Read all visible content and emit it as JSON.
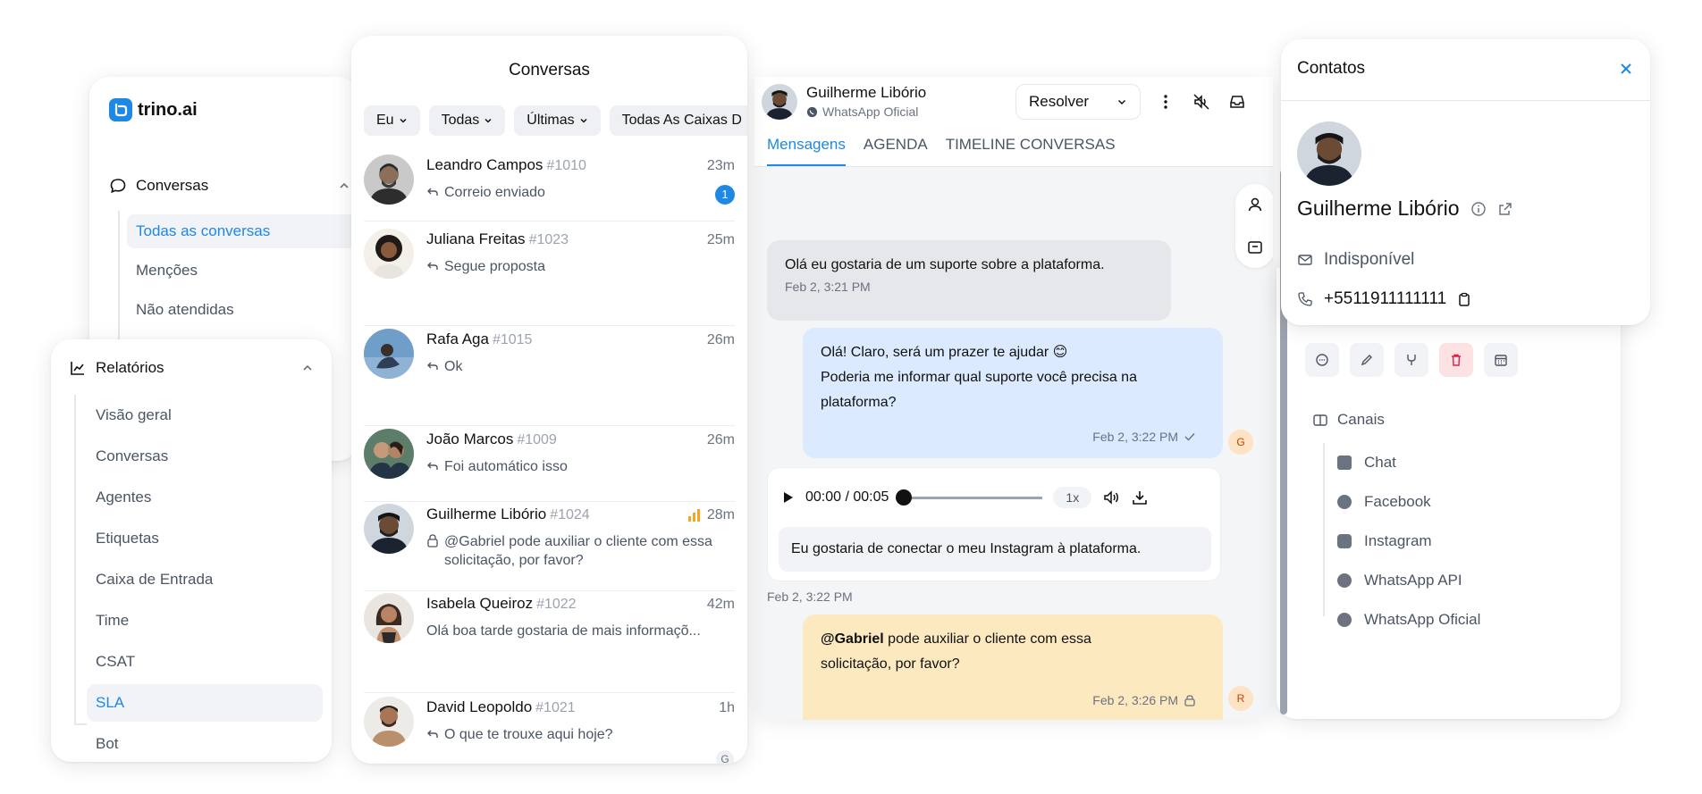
{
  "brand": {
    "logo_text": "trino.ai",
    "accent": "#1e88e5"
  },
  "sidebar": {
    "section": "Conversas",
    "items": [
      {
        "label": "Todas as conversas",
        "active": true
      },
      {
        "label": "Menções"
      },
      {
        "label": "Não atendidas"
      }
    ]
  },
  "reports": {
    "section": "Relatórios",
    "items": [
      {
        "label": "Visão geral"
      },
      {
        "label": "Conversas"
      },
      {
        "label": "Agentes"
      },
      {
        "label": "Etiquetas"
      },
      {
        "label": "Caixa de Entrada"
      },
      {
        "label": "Time"
      },
      {
        "label": "CSAT"
      },
      {
        "label": "SLA",
        "active": true
      },
      {
        "label": "Bot"
      }
    ]
  },
  "conversations": {
    "title": "Conversas",
    "filters": [
      "Eu",
      "Todas",
      "Últimas",
      "Todas As Caixas D"
    ],
    "items": [
      {
        "name": "Leandro Campos",
        "id": "#1010",
        "time": "23m",
        "message": "Correio enviado",
        "unread": "1",
        "icon": "reply-icon"
      },
      {
        "name": "Juliana Freitas",
        "id": "#1023",
        "time": "25m",
        "message": "Segue proposta",
        "icon": "reply-icon"
      },
      {
        "name": "Rafa Aga",
        "id": "#1015",
        "time": "26m",
        "message": "Ok",
        "icon": "reply-icon"
      },
      {
        "name": "João Marcos",
        "id": "#1009",
        "time": "26m",
        "message": "Foi automático isso",
        "icon": "reply-icon"
      },
      {
        "name": "Guilherme Libório",
        "id": "#1024",
        "time": "28m",
        "message": "@Gabriel pode auxiliar o cliente com essa solicitação, por favor?",
        "icon": "lock-icon",
        "priority": true
      },
      {
        "name": "Isabela Queiroz",
        "id": "#1022",
        "time": "42m",
        "message": "Olá boa tarde gostaria de mais informaçõ..."
      },
      {
        "name": "David Leopoldo",
        "id": "#1021",
        "time": "1h",
        "message": "O que te trouxe aqui hoje?",
        "icon": "reply-icon"
      }
    ],
    "assignee_badge": "G"
  },
  "chat": {
    "contact_name": "Guilherme Libório",
    "channel": "WhatsApp Oficial",
    "resolve_label": "Resolver",
    "tabs": [
      {
        "label": "Mensagens",
        "active": true
      },
      {
        "label": "AGENDA"
      },
      {
        "label": "TIMELINE CONVERSAS"
      }
    ],
    "messages": [
      {
        "text": "Olá eu gostaria de um suporte sobre a plataforma.",
        "time": "Feb 2, 3:21 PM"
      },
      {
        "text_line1": "Olá! Claro, será um prazer te ajudar 😊",
        "text_line2": "Poderia me informar qual suporte você precisa na",
        "text_line3": "plataforma?",
        "time": "Feb 2, 3:22 PM",
        "author_initial": "G"
      },
      {
        "audio_time": "00:00 / 00:05",
        "audio_progress": 0,
        "speed": "1x",
        "transcript": "Eu gostaria de conectar o meu Instagram à plataforma.",
        "time": "Feb 2, 3:22 PM"
      },
      {
        "mention": "@Gabriel",
        "text_rest": " pode auxiliar o cliente com essa",
        "text_line2": "solicitação, por favor?",
        "time": "Feb 2, 3:26 PM",
        "author_initial": "R"
      }
    ]
  },
  "contact": {
    "title": "Contatos",
    "name": "Guilherme Libório",
    "email": "Indisponível",
    "phone": "+5511911111111",
    "channels_title": "Canais",
    "channels": [
      "Chat",
      "Facebook",
      "Instagram",
      "WhatsApp API",
      "WhatsApp Oficial"
    ]
  }
}
